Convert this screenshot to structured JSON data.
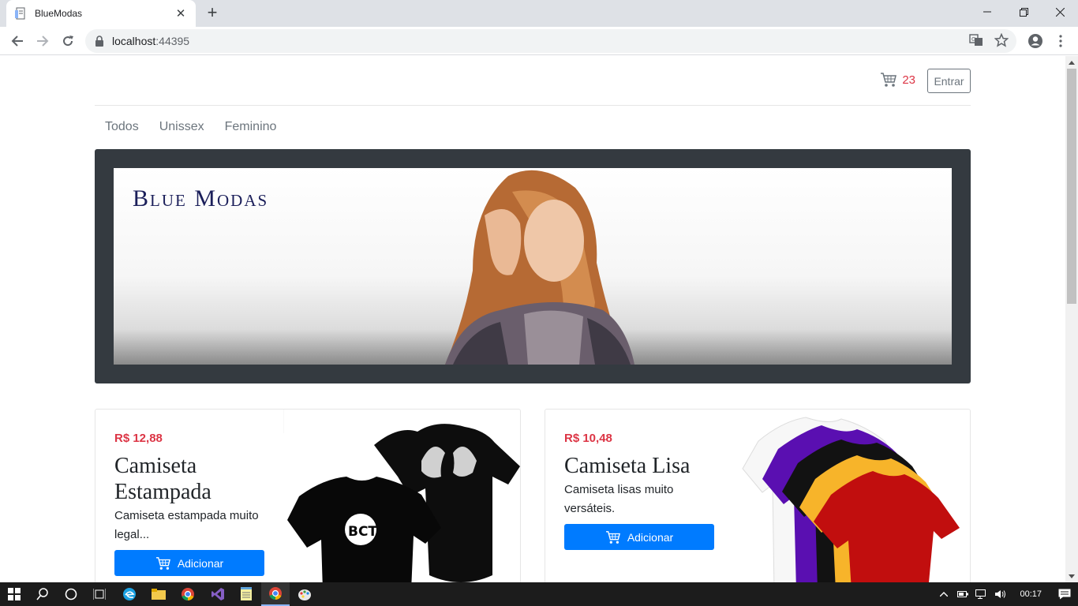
{
  "browser": {
    "tab_title": "BlueModas",
    "url_host": "localhost",
    "url_port": ":44395"
  },
  "header": {
    "cart_count": "23",
    "login_label": "Entrar"
  },
  "categories": [
    "Todos",
    "Unissex",
    "Feminino"
  ],
  "banner": {
    "title": "Blue Modas"
  },
  "products": [
    {
      "price": "R$ 12,88",
      "name": "Camiseta Estampada",
      "description": "Camiseta estampada muito legal...",
      "button_label": "Adicionar"
    },
    {
      "price": "R$ 10,48",
      "name": "Camiseta Lisa",
      "description": "Camiseta lisas muito versáteis.",
      "button_label": "Adicionar"
    }
  ],
  "taskbar": {
    "time": "00:17"
  },
  "colors": {
    "primary": "#007bff",
    "price": "#dc3545",
    "banner_frame": "#343a40",
    "brand_text": "#1b1f5a"
  }
}
